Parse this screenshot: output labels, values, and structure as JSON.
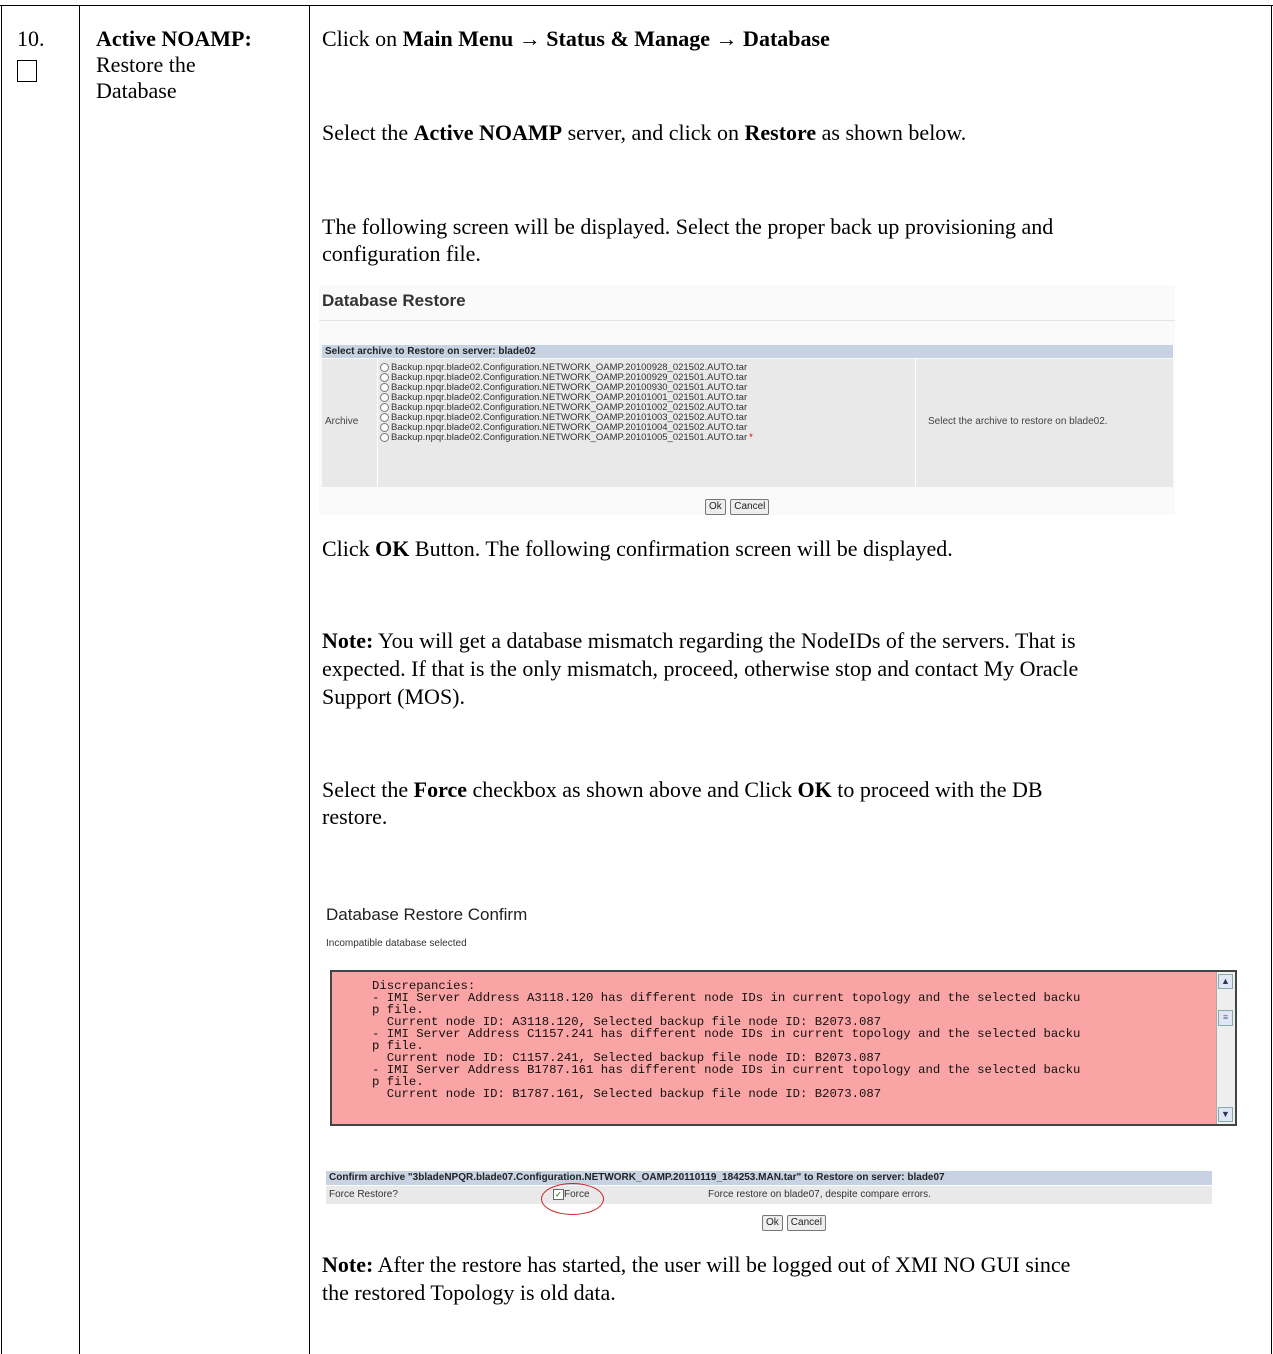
{
  "step": {
    "number": "10.",
    "title": "Active NOAMP:",
    "subtitle_lines": [
      "Restore the",
      "Database"
    ]
  },
  "instructions": {
    "p1_pre": "Click on ",
    "p1_bold": "Main Menu → Status & Manage → Database",
    "p2_pre": "Select the ",
    "p2_bold1": "Active NOAMP",
    "p2_mid": " server, and click on ",
    "p2_bold2": "Restore",
    "p2_post": " as shown below.",
    "p3_line1": "The following screen will be displayed. Select the proper back up provisioning and",
    "p3_line2": "configuration file.",
    "p4_pre": "Click ",
    "p4_bold": "OK",
    "p4_post": " Button. The following confirmation screen will be displayed.",
    "note1_label": "Note:",
    "note1_line1": " You will get a database mismatch regarding the NodeIDs of the servers. That is",
    "note1_line2": "expected. If that is the only mismatch, proceed, otherwise stop and contact My Oracle",
    "note1_line3": "Support (MOS).",
    "p5_pre": "Select the ",
    "p5_bold1": "Force",
    "p5_mid": " checkbox as shown above and Click ",
    "p5_bold2": "OK",
    "p5_post": " to proceed with the DB",
    "p5_line2": "restore.",
    "note2_label": "Note:",
    "note2_line1": " After the restore has started, the user will be logged out of XMI NO GUI since",
    "note2_line2": "the restored Topology is old data."
  },
  "restore_screen": {
    "title": "Database Restore",
    "header": "Select archive to Restore on server: blade02",
    "row_label": "Archive",
    "archives": [
      "Backup.npqr.blade02.Configuration.NETWORK_OAMP.20100928_021502.AUTO.tar",
      "Backup.npqr.blade02.Configuration.NETWORK_OAMP.20100929_021501.AUTO.tar",
      "Backup.npqr.blade02.Configuration.NETWORK_OAMP.20100930_021501.AUTO.tar",
      "Backup.npqr.blade02.Configuration.NETWORK_OAMP.20101001_021501.AUTO.tar",
      "Backup.npqr.blade02.Configuration.NETWORK_OAMP.20101002_021502.AUTO.tar",
      "Backup.npqr.blade02.Configuration.NETWORK_OAMP.20101003_021502.AUTO.tar",
      "Backup.npqr.blade02.Configuration.NETWORK_OAMP.20101004_021502.AUTO.tar",
      "Backup.npqr.blade02.Configuration.NETWORK_OAMP.20101005_021501.AUTO.tar"
    ],
    "required_marker": "*",
    "help_text": "Select the archive to restore on blade02.",
    "ok_label": "Ok",
    "cancel_label": "Cancel"
  },
  "confirm_screen": {
    "title": "Database Restore Confirm",
    "subtitle": "Incompatible database selected",
    "discrepancies": "Discrepancies:\n- IMI Server Address A3118.120 has different node IDs in current topology and the selected backu\np file.\n  Current node ID: A3118.120, Selected backup file node ID: B2073.087\n- IMI Server Address C1157.241 has different node IDs in current topology and the selected backu\np file.\n  Current node ID: C1157.241, Selected backup file node ID: B2073.087\n- IMI Server Address B1787.161 has different node IDs in current topology and the selected backu\np file.\n  Current node ID: B1787.161, Selected backup file node ID: B2073.087",
    "confirm_header": "Confirm archive \"3bladeNPQR.blade07.Configuration.NETWORK_OAMP.20110119_184253.MAN.tar\" to Restore on server: blade07",
    "force_label": "Force Restore?",
    "force_checkbox_label": "Force",
    "force_help": "Force restore on blade07, despite compare errors.",
    "ok_label": "Ok",
    "cancel_label": "Cancel",
    "highlight_color": "#d0202a"
  }
}
